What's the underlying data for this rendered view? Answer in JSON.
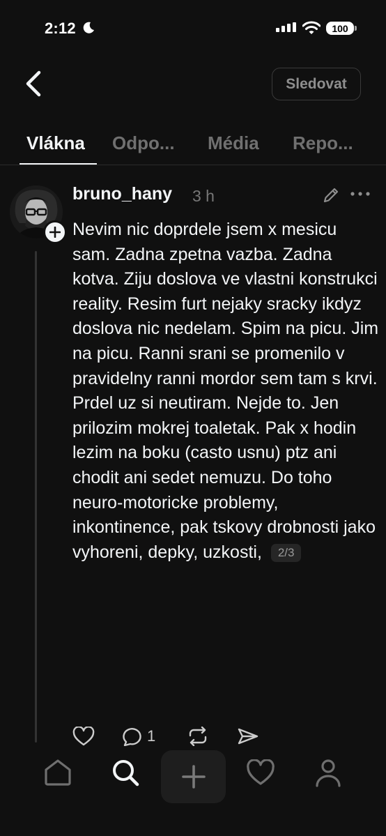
{
  "status_bar": {
    "time": "2:12",
    "battery": "100"
  },
  "header": {
    "back_icon": "chevron-left-icon",
    "follow_label": "Sledovat"
  },
  "tabs": [
    {
      "label": "Vlákna",
      "active": true
    },
    {
      "label": "Odpo...",
      "active": false
    },
    {
      "label": "Média",
      "active": false
    },
    {
      "label": "Repo...",
      "active": false
    }
  ],
  "post": {
    "username": "bruno_hany",
    "time": "3 h",
    "text": "Nevim nic doprdele jsem x mesicu sam. Zadna zpetna vazba. Zadna kotva. Ziju doslova ve vlastni konstrukci reality. Resim furt nejaky sracky ikdyz doslova nic nedelam. Spim na picu. Jim na picu. Ranni srani se promenilo v pravidelny ranni mordor sem tam s krvi. Prdel uz si neutiram. Nejde to. Jen prilozim mokrej toaletak. Pak x hodin lezim na boku (casto usnu) ptz ani chodit ani sedet nemuzu. Do toho neuro-motoricke problemy, inkontinence, pak tskovy drobnosti jako vyhoreni, depky, uzkosti,",
    "page_indicator": "2/3",
    "reply_count": "1"
  },
  "colors": {
    "background": "#101010",
    "text": "#f3f5f7",
    "muted": "#777777",
    "divider": "#2a2a2a"
  }
}
